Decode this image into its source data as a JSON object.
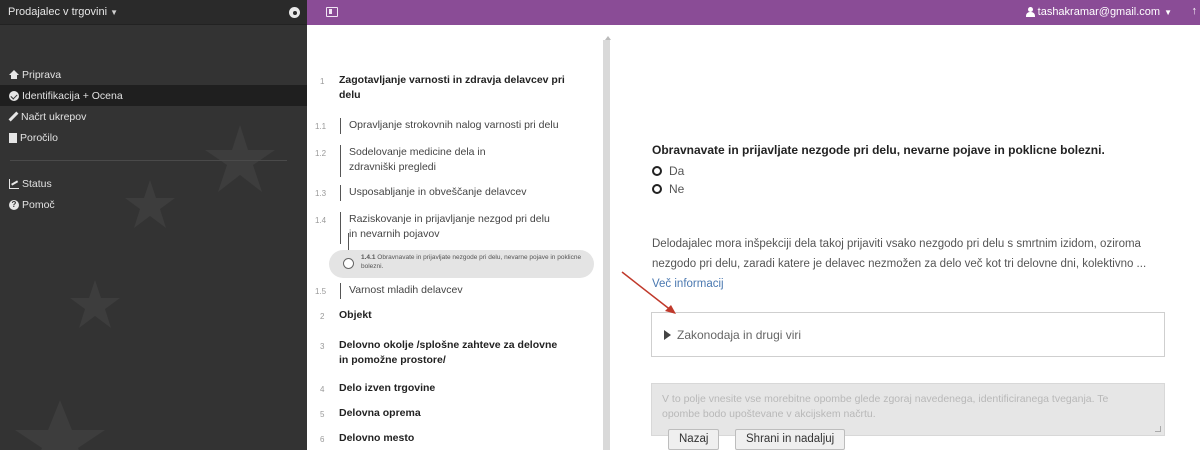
{
  "sidebar": {
    "role_label": "Prodajalec v trgovini",
    "items": [
      {
        "label": "Priprava",
        "icon": "home-icon"
      },
      {
        "label": "Identifikacija + Ocena",
        "icon": "check-circle-icon",
        "active": true
      },
      {
        "label": "Načrt ukrepov",
        "icon": "pencil-icon"
      },
      {
        "label": "Poročilo",
        "icon": "document-icon"
      },
      {
        "label": "Status",
        "icon": "chart-icon"
      },
      {
        "label": "Pomoč",
        "icon": "help-icon"
      }
    ]
  },
  "header": {
    "user_email": "tashakramar@gmail.com",
    "accent_color": "#8a4c96"
  },
  "tree": {
    "items": [
      {
        "num": "1",
        "label": "Zagotavljanje varnosti in zdravja delavcev pri delu",
        "bold": true
      },
      {
        "num": "1.1",
        "label": "Opravljanje strokovnih nalog varnosti pri delu"
      },
      {
        "num": "1.2",
        "label": "Sodelovanje medicine dela in zdravniški pregledi"
      },
      {
        "num": "1.3",
        "label": "Usposabljanje in obveščanje delavcev"
      },
      {
        "num": "1.4",
        "label": "Raziskovanje in prijavljanje nezgod pri delu in nevarnih pojavov"
      },
      {
        "num": "1.4.1",
        "label": "Obravnavate in prijavljate nezgode pri delu, nevarne pojave in poklicne bolezni.",
        "active": true
      },
      {
        "num": "1.5",
        "label": "Varnost mladih delavcev"
      },
      {
        "num": "2",
        "label": "Objekt",
        "bold": true
      },
      {
        "num": "3",
        "label": "Delovno okolje /splošne zahteve za delovne in pomožne prostore/",
        "bold": true
      },
      {
        "num": "4",
        "label": "Delo izven trgovine",
        "bold": true
      },
      {
        "num": "5",
        "label": "Delovna oprema",
        "bold": true
      },
      {
        "num": "6",
        "label": "Delovno mesto",
        "bold": true
      }
    ]
  },
  "question": {
    "title": "Obravnavate in prijavljate nezgode pri delu, nevarne pojave in poklicne bolezni.",
    "options": [
      "Da",
      "Ne"
    ],
    "description": "Delodajalec mora inšpekciji dela takoj prijaviti vsako nezgodo pri delu s smrtnim izidom, oziroma nezgodo pri delu, zaradi katere je delavec nezmožen za delo več kot tri delovne dni, kolektivno ... ",
    "more_link": "Več informacij",
    "legislation_label": "Zakonodaja in drugi viri",
    "notes_placeholder": "V to polje vnesite vse morebitne opombe glede zgoraj navedenega, identificiranega tveganja. Te opombe bodo upoštevane v akcijskem načrtu."
  },
  "buttons": {
    "back": "Nazaj",
    "save_continue": "Shrani in nadaljuj"
  }
}
